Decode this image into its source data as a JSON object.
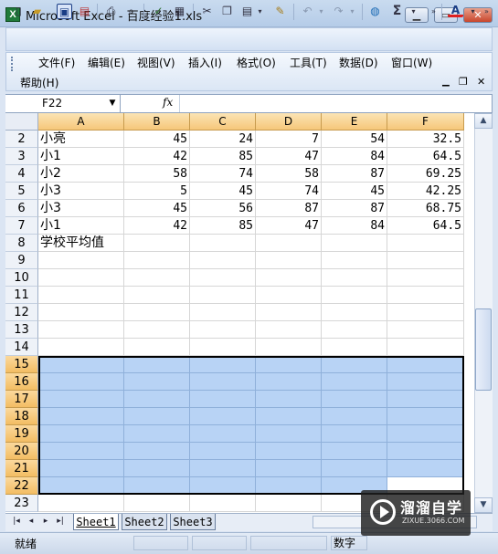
{
  "window": {
    "title": "Microsoft Excel - 百度经验1.xls",
    "app_icon": "X",
    "controls": [
      "minimize-icon",
      "maximize-icon",
      "close-icon"
    ]
  },
  "toolbar": {
    "icons": [
      "new-icon",
      "open-icon",
      "save-icon",
      "permission-icon",
      "print-icon",
      "print-preview-icon",
      "spelling-icon",
      "research-icon",
      "cut-icon",
      "copy-icon",
      "paste-icon",
      "format-painter-icon",
      "undo-icon",
      "redo-icon",
      "hyperlink-icon",
      "autosum-icon",
      "font-color-icon"
    ],
    "autosum_label": "Σ",
    "font_color_label": "A",
    "font_color": "#e02020"
  },
  "menu": {
    "items": [
      "文件(F)",
      "编辑(E)",
      "视图(V)",
      "插入(I)",
      "格式(O)",
      "工具(T)",
      "数据(D)",
      "窗口(W)"
    ],
    "help": "帮助(H)"
  },
  "formula_bar": {
    "name_box": "F22",
    "fx": "fx",
    "formula": ""
  },
  "sheet": {
    "columns": [
      "A",
      "B",
      "C",
      "D",
      "E",
      "F"
    ],
    "rows": [
      {
        "num": "2",
        "cells": [
          "小亮",
          "45",
          "24",
          "7",
          "54",
          "32.5"
        ]
      },
      {
        "num": "3",
        "cells": [
          "小1",
          "42",
          "85",
          "47",
          "84",
          "64.5"
        ]
      },
      {
        "num": "4",
        "cells": [
          "小2",
          "58",
          "74",
          "58",
          "87",
          "69.25"
        ]
      },
      {
        "num": "5",
        "cells": [
          "小3",
          "5",
          "45",
          "74",
          "45",
          "42.25"
        ]
      },
      {
        "num": "6",
        "cells": [
          "小3",
          "45",
          "56",
          "87",
          "87",
          "68.75"
        ]
      },
      {
        "num": "7",
        "cells": [
          "小1",
          "42",
          "85",
          "47",
          "84",
          "64.5"
        ]
      },
      {
        "num": "8",
        "cells": [
          "学校平均值",
          "",
          "",
          "",
          "",
          ""
        ]
      },
      {
        "num": "9",
        "cells": [
          "",
          "",
          "",
          "",
          "",
          ""
        ]
      },
      {
        "num": "10",
        "cells": [
          "",
          "",
          "",
          "",
          "",
          ""
        ]
      },
      {
        "num": "11",
        "cells": [
          "",
          "",
          "",
          "",
          "",
          ""
        ]
      },
      {
        "num": "12",
        "cells": [
          "",
          "",
          "",
          "",
          "",
          ""
        ]
      },
      {
        "num": "13",
        "cells": [
          "",
          "",
          "",
          "",
          "",
          ""
        ]
      },
      {
        "num": "14",
        "cells": [
          "",
          "",
          "",
          "",
          "",
          ""
        ]
      },
      {
        "num": "15",
        "cells": [
          "",
          "",
          "",
          "",
          "",
          ""
        ]
      },
      {
        "num": "16",
        "cells": [
          "",
          "",
          "",
          "",
          "",
          ""
        ]
      },
      {
        "num": "17",
        "cells": [
          "",
          "",
          "",
          "",
          "",
          ""
        ]
      },
      {
        "num": "18",
        "cells": [
          "",
          "",
          "",
          "",
          "",
          ""
        ]
      },
      {
        "num": "19",
        "cells": [
          "",
          "",
          "",
          "",
          "",
          ""
        ]
      },
      {
        "num": "20",
        "cells": [
          "",
          "",
          "",
          "",
          "",
          ""
        ]
      },
      {
        "num": "21",
        "cells": [
          "",
          "",
          "",
          "",
          "",
          ""
        ]
      },
      {
        "num": "22",
        "cells": [
          "",
          "",
          "",
          "",
          "",
          ""
        ]
      },
      {
        "num": "23",
        "cells": [
          "",
          "",
          "",
          "",
          "",
          ""
        ]
      }
    ],
    "selection": "A15:F22",
    "active_cell": "F22",
    "selection_color": "#b8d3f5"
  },
  "tabs": {
    "nav": [
      "first-sheet-icon",
      "prev-sheet-icon",
      "next-sheet-icon",
      "last-sheet-icon"
    ],
    "sheets": [
      "Sheet1",
      "Sheet2",
      "Sheet3"
    ],
    "active": "Sheet1"
  },
  "status": {
    "left": "就绪",
    "mode": "数字"
  },
  "watermark": {
    "text": "溜溜自学",
    "url": "ZIXUE.3066.COM"
  }
}
